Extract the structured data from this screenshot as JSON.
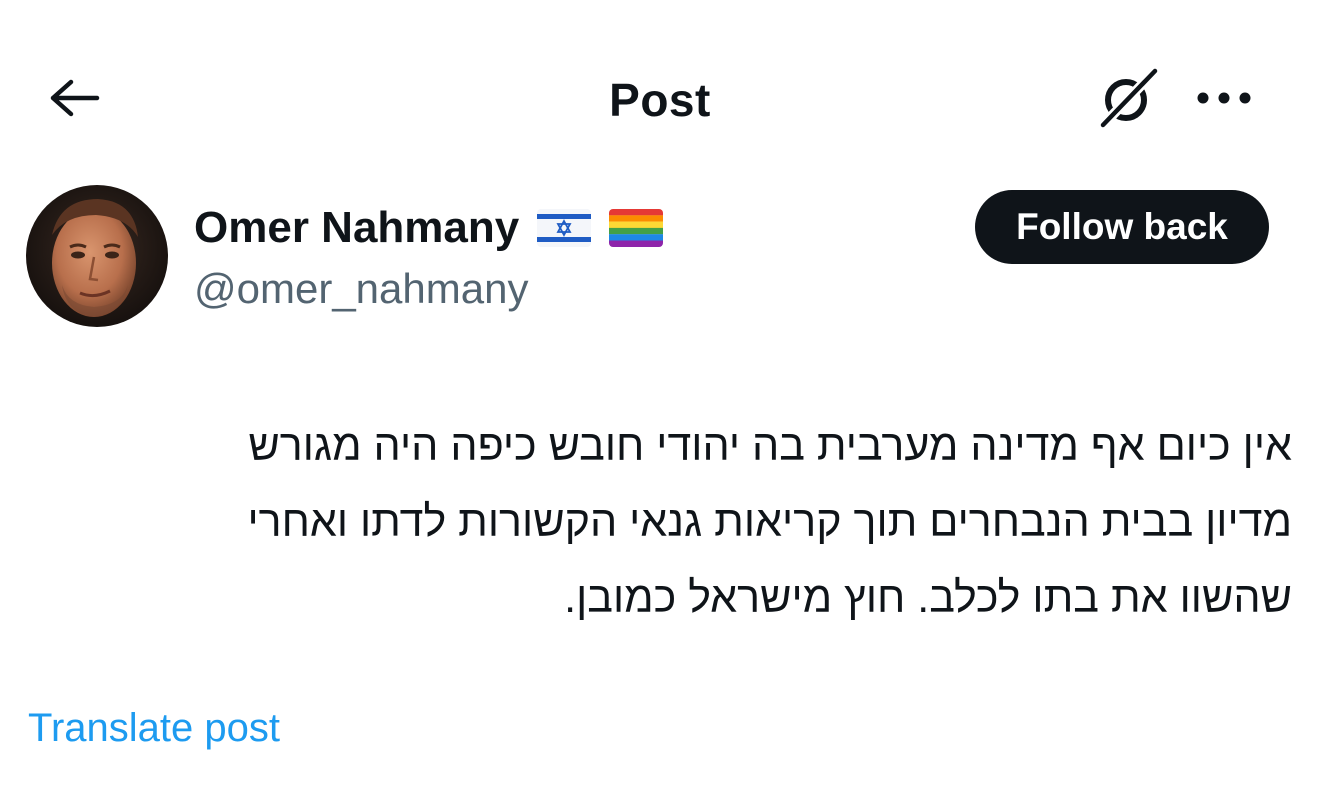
{
  "header": {
    "title": "Post",
    "back_icon": "arrow-left-icon",
    "grok_icon": "grok-icon",
    "more_icon": "more-dots-icon"
  },
  "author": {
    "display_name": "Omer Nahmany",
    "handle": "@omer_nahmany",
    "badges": [
      "israel-flag",
      "rainbow-flag"
    ],
    "follow_label": "Follow back"
  },
  "post": {
    "lines": [
      "אין כיום אף מדינה מערבית בה יהודי חובש כיפה היה מגורש",
      "מדיון בבית הנבחרים תוך קריאות גנאי הקשורות לדתו ואחרי",
      "שהשוו את בתו לכלב. חוץ מישראל כמובן."
    ],
    "translate_label": "Translate post"
  },
  "colors": {
    "text": "#0f1419",
    "secondary": "#536471",
    "link": "#1d9bf0",
    "button_bg": "#0f1419"
  }
}
